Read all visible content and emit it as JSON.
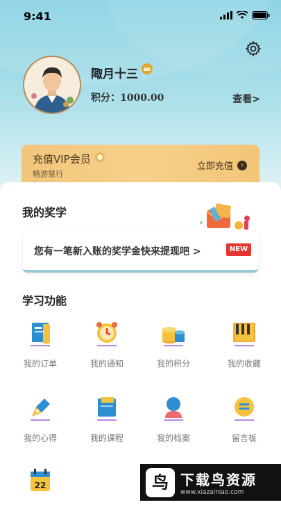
{
  "status": {
    "time": "9:41"
  },
  "profile": {
    "name": "陬月十三",
    "points_label": "积分：1000.00",
    "view_label": "查看>"
  },
  "vip": {
    "title": "充值VIP会员",
    "subtitle": "畅游慧行",
    "button_label": "立即充值"
  },
  "scholarship": {
    "section_title": "我的奖学",
    "card_text": "您有一笔新入账的奖学金快来提现吧 >",
    "new_badge": "NEW"
  },
  "features": {
    "section_title": "学习功能",
    "items": [
      {
        "label": "我的订单",
        "icon": "orders-book-icon"
      },
      {
        "label": "我的通知",
        "icon": "alarm-clock-icon"
      },
      {
        "label": "我的积分",
        "icon": "coin-stack-icon"
      },
      {
        "label": "我的收藏",
        "icon": "piano-keys-icon"
      },
      {
        "label": "我的心得",
        "icon": "pen-nib-icon"
      },
      {
        "label": "我的课程",
        "icon": "open-book-icon"
      },
      {
        "label": "我的档案",
        "icon": "user-profile-icon"
      },
      {
        "label": "留言板",
        "icon": "message-coin-icon"
      },
      {
        "label": "22",
        "icon": "calendar-icon"
      }
    ]
  },
  "watermark": {
    "title": "下载鸟资源",
    "url": "www.xiazainiao.com",
    "logo": "鸟"
  },
  "colors": {
    "accent": "#e5352f",
    "header": "#86d1e3",
    "vip": "#f2c57a"
  }
}
